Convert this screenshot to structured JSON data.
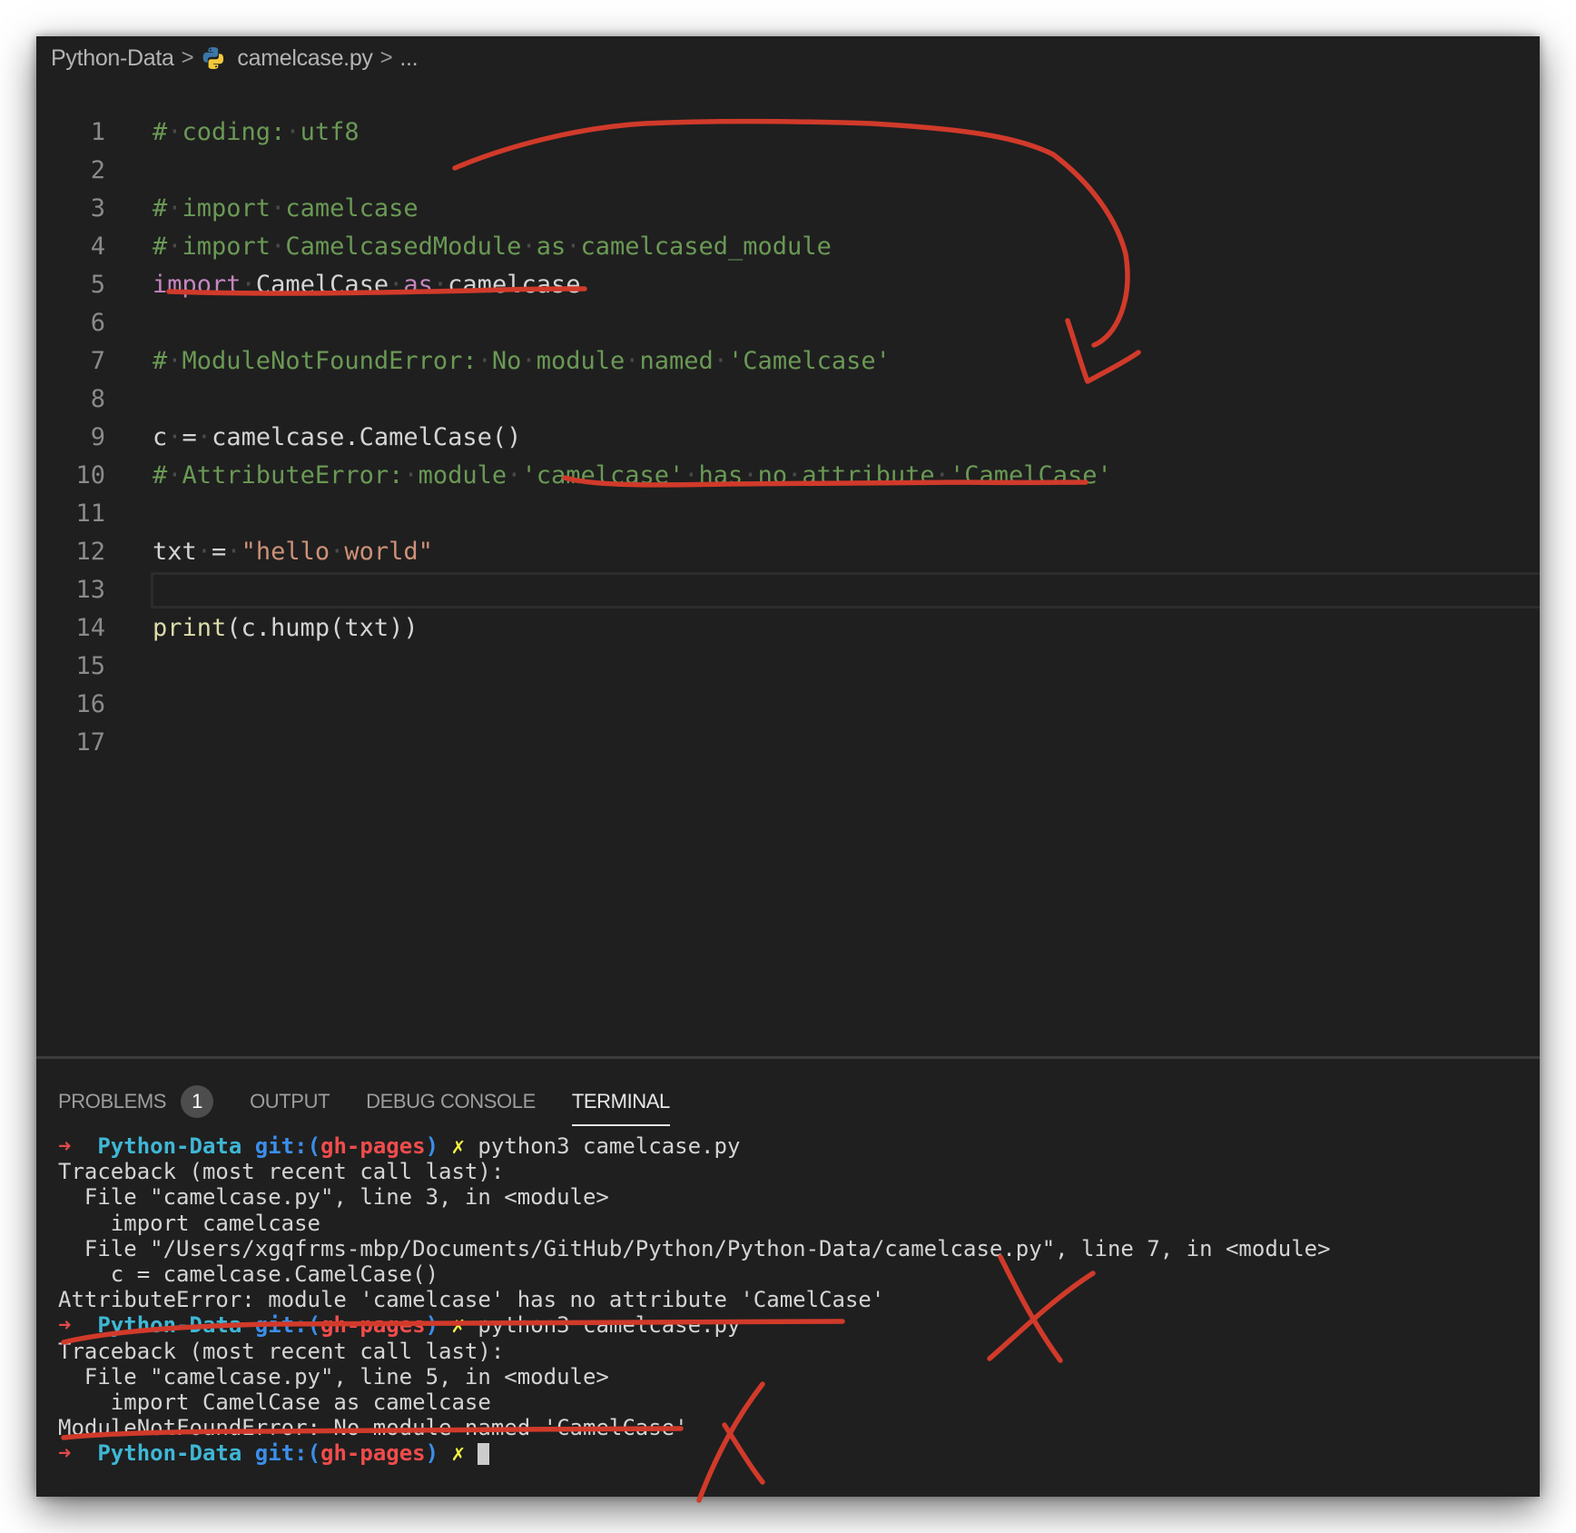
{
  "breadcrumb": {
    "folder": "Python-Data",
    "file": "camelcase.py",
    "separator": ">",
    "more": "...",
    "file_icon": "python-icon"
  },
  "editor": {
    "current_line": 13,
    "lines": [
      {
        "n": "1",
        "tokens": [
          {
            "t": "# coding: utf8",
            "c": "comment"
          }
        ]
      },
      {
        "n": "2",
        "tokens": []
      },
      {
        "n": "3",
        "tokens": [
          {
            "t": "# import camelcase",
            "c": "comment"
          }
        ]
      },
      {
        "n": "4",
        "tokens": [
          {
            "t": "# import CamelcasedModule as camelcased_module",
            "c": "comment"
          }
        ]
      },
      {
        "n": "5",
        "tokens": [
          {
            "t": "import",
            "c": "keyword"
          },
          {
            "t": " CamelCase ",
            "c": "plain"
          },
          {
            "t": "as",
            "c": "keyword"
          },
          {
            "t": " camelcase",
            "c": "plain"
          }
        ]
      },
      {
        "n": "6",
        "tokens": []
      },
      {
        "n": "7",
        "tokens": [
          {
            "t": "# ModuleNotFoundError: No module named 'Camelcase'",
            "c": "comment"
          }
        ]
      },
      {
        "n": "8",
        "tokens": []
      },
      {
        "n": "9",
        "tokens": [
          {
            "t": "c = camelcase.CamelCase()",
            "c": "plain"
          }
        ]
      },
      {
        "n": "10",
        "tokens": [
          {
            "t": "# AttributeError: module 'camelcase' has no attribute 'CamelCase'",
            "c": "comment"
          }
        ]
      },
      {
        "n": "11",
        "tokens": []
      },
      {
        "n": "12",
        "tokens": [
          {
            "t": "txt = ",
            "c": "plain"
          },
          {
            "t": "\"hello world\"",
            "c": "string"
          }
        ]
      },
      {
        "n": "13",
        "tokens": []
      },
      {
        "n": "14",
        "tokens": [
          {
            "t": "print",
            "c": "func"
          },
          {
            "t": "(c.hump(txt))",
            "c": "plain"
          }
        ]
      },
      {
        "n": "15",
        "tokens": []
      },
      {
        "n": "16",
        "tokens": []
      },
      {
        "n": "17",
        "tokens": []
      }
    ]
  },
  "panel": {
    "tabs": [
      {
        "label": "PROBLEMS",
        "badge": "1",
        "active": false
      },
      {
        "label": "OUTPUT",
        "active": false
      },
      {
        "label": "DEBUG CONSOLE",
        "active": false
      },
      {
        "label": "TERMINAL",
        "active": true
      }
    ],
    "terminal": {
      "prompt": {
        "arrow": "➜",
        "dir": "Python-Data",
        "git_prefix": "git:(",
        "branch": "gh-pages",
        "git_suffix": ")",
        "dirty": "✗"
      },
      "lines": [
        {
          "type": "prompt",
          "cmd": "python3 camelcase.py"
        },
        {
          "type": "out",
          "text": "Traceback (most recent call last):"
        },
        {
          "type": "out",
          "text": "  File \"camelcase.py\", line 3, in <module>"
        },
        {
          "type": "out",
          "text": "    import camelcase"
        },
        {
          "type": "out",
          "text": "  File \"/Users/xgqfrms-mbp/Documents/GitHub/Python/Python-Data/camelcase.py\", line 7, in <module>"
        },
        {
          "type": "out",
          "text": "    c = camelcase.CamelCase()"
        },
        {
          "type": "out",
          "text": "AttributeError: module 'camelcase' has no attribute 'CamelCase'"
        },
        {
          "type": "prompt",
          "cmd": "python3 camelcase.py"
        },
        {
          "type": "out",
          "text": "Traceback (most recent call last):"
        },
        {
          "type": "out",
          "text": "  File \"camelcase.py\", line 5, in <module>"
        },
        {
          "type": "out",
          "text": "    import CamelCase as camelcase"
        },
        {
          "type": "out",
          "text": "ModuleNotFoundError: No module named 'CamelCase'"
        },
        {
          "type": "prompt",
          "cmd": "",
          "cursor": true
        }
      ]
    }
  },
  "annotations": {
    "color": "#d13a2a",
    "marks": [
      "underline-import-line",
      "arrow-to-attribute-error",
      "underline-attribute-error-comment",
      "underline-terminal-attribute-error",
      "cross-mark-1",
      "underline-terminal-module-error",
      "cross-mark-2"
    ]
  }
}
